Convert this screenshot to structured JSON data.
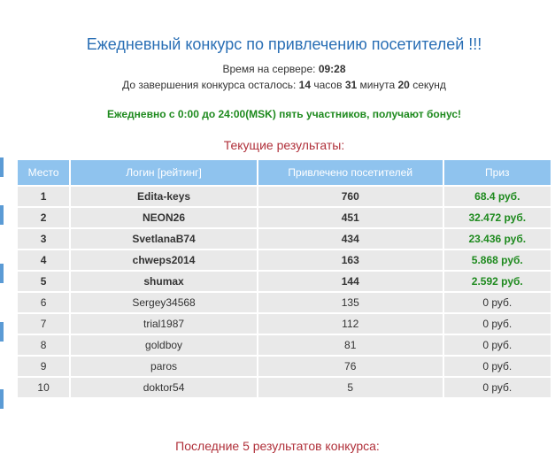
{
  "header": {
    "title": "Ежедневный конкурс по привлечению посетителей !!!",
    "server_time_label": "Время на сервере:",
    "server_time_value": "09:28",
    "remaining_label": "До завершения конкурса осталось:",
    "remaining_hours": "14",
    "hours_word": "часов",
    "remaining_minutes": "31",
    "minutes_word": "минута",
    "remaining_seconds": "20",
    "seconds_word": "секунд"
  },
  "bonus_text": "Ежедневно с 0:00 до 24:00(MSK) пять участников, получают бонус!",
  "results": {
    "title": "Текущие результаты:",
    "columns": [
      "Место",
      "Логин [рейтинг]",
      "Привлечено посетителей",
      "Приз"
    ],
    "rows": [
      {
        "place": "1",
        "login": "Edita-keys",
        "count": "760",
        "prize": "68.4 руб."
      },
      {
        "place": "2",
        "login": "NEON26",
        "count": "451",
        "prize": "32.472 руб."
      },
      {
        "place": "3",
        "login": "SvetlanaB74",
        "count": "434",
        "prize": "23.436 руб."
      },
      {
        "place": "4",
        "login": "chweps2014",
        "count": "163",
        "prize": "5.868 руб."
      },
      {
        "place": "5",
        "login": "shumax",
        "count": "144",
        "prize": "2.592 руб."
      },
      {
        "place": "6",
        "login": "Sergey34568",
        "count": "135",
        "prize": "0 руб."
      },
      {
        "place": "7",
        "login": "trial1987",
        "count": "112",
        "prize": "0 руб."
      },
      {
        "place": "8",
        "login": "goldboy",
        "count": "81",
        "prize": "0 руб."
      },
      {
        "place": "9",
        "login": "paros",
        "count": "76",
        "prize": "0 руб."
      },
      {
        "place": "10",
        "login": "doktor54",
        "count": "5",
        "prize": "0 руб."
      }
    ]
  },
  "footer_title": "Последние 5 результатов конкурса:",
  "colors": {
    "title": "#2a6fb5",
    "bonus": "#1e8a1e",
    "section_title": "#b0303a",
    "header_bg": "#8fc3ee",
    "row_bg": "#e9e9e9"
  }
}
